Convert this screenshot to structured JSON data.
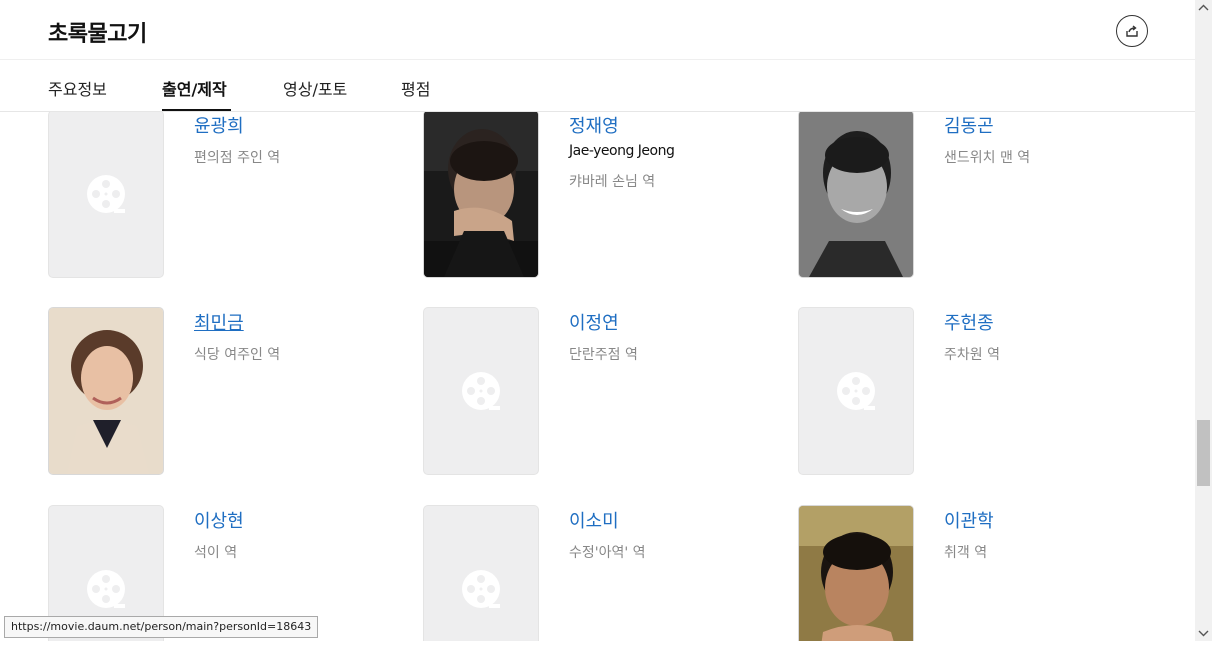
{
  "header": {
    "title": "초록물고기",
    "share_icon": "share-icon"
  },
  "tabs": [
    {
      "label": "주요정보",
      "active": false
    },
    {
      "label": "출연/제작",
      "active": true
    },
    {
      "label": "영상/포토",
      "active": false
    },
    {
      "label": "평점",
      "active": false
    }
  ],
  "cast": [
    {
      "name": "윤광희",
      "english": "",
      "role": "편의점 주인 역",
      "photo": false
    },
    {
      "name": "정재영",
      "english": "Jae-yeong Jeong",
      "role": "캬바레 손님 역",
      "photo": true
    },
    {
      "name": "김동곤",
      "english": "",
      "role": "샌드위치 맨 역",
      "photo": true
    },
    {
      "name": "최민금",
      "english": "",
      "role": "식당 여주인 역",
      "photo": true
    },
    {
      "name": "이정연",
      "english": "",
      "role": "단란주점 역",
      "photo": false
    },
    {
      "name": "주헌종",
      "english": "",
      "role": "주차원 역",
      "photo": false
    },
    {
      "name": "이상현",
      "english": "",
      "role": "석이 역",
      "photo": false
    },
    {
      "name": "이소미",
      "english": "",
      "role": "수정'아역' 역",
      "photo": false
    },
    {
      "name": "이관학",
      "english": "",
      "role": "취객 역",
      "photo": true
    }
  ],
  "status_bar": {
    "url": "https://movie.daum.net/person/main?personId=18643"
  },
  "colors": {
    "link": "#1f6ec2",
    "role_text": "#888888",
    "placeholder_bg": "#eeeeef"
  }
}
